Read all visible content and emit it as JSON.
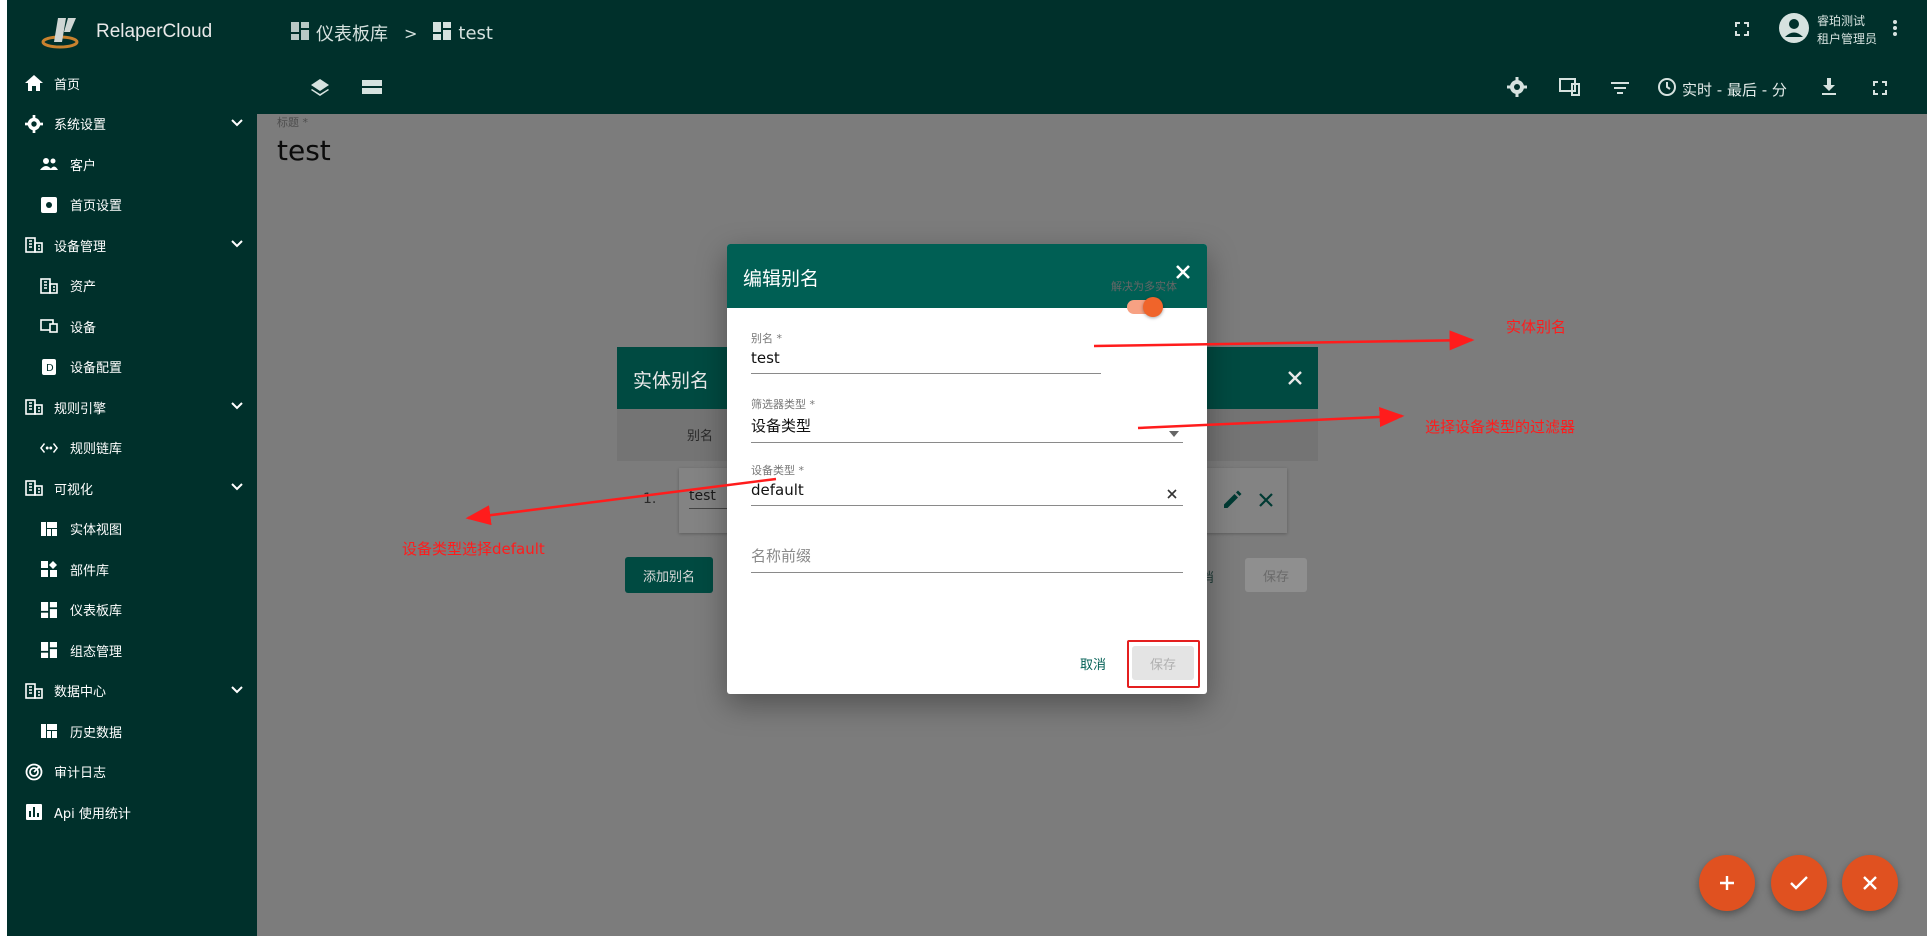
{
  "app": {
    "brand": "RelaperCloud"
  },
  "sidebar": {
    "items": [
      {
        "label": "首页",
        "icon": "home-icon",
        "level": 1
      },
      {
        "label": "系统设置",
        "icon": "gear-icon",
        "level": 1,
        "expandable": true
      },
      {
        "label": "客户",
        "icon": "people-icon",
        "level": 2
      },
      {
        "label": "首页设置",
        "icon": "dashboard-settings-icon",
        "level": 2
      },
      {
        "label": "设备管理",
        "icon": "building-icon",
        "level": 1,
        "expandable": true
      },
      {
        "label": "资产",
        "icon": "building-icon",
        "level": 2
      },
      {
        "label": "设备",
        "icon": "devices-icon",
        "level": 2
      },
      {
        "label": "设备配置",
        "icon": "device-profile-icon",
        "level": 2
      },
      {
        "label": "规则引擎",
        "icon": "building-icon",
        "level": 1,
        "expandable": true
      },
      {
        "label": "规则链库",
        "icon": "rule-chain-icon",
        "level": 2
      },
      {
        "label": "可视化",
        "icon": "building-icon",
        "level": 1,
        "expandable": true
      },
      {
        "label": "实体视图",
        "icon": "view-quilt-icon",
        "level": 2
      },
      {
        "label": "部件库",
        "icon": "widgets-icon",
        "level": 2
      },
      {
        "label": "仪表板库",
        "icon": "dashboard-icon",
        "level": 2
      },
      {
        "label": "组态管理",
        "icon": "dashboard-icon",
        "level": 2
      },
      {
        "label": "数据中心",
        "icon": "building-icon",
        "level": 1,
        "expandable": true
      },
      {
        "label": "历史数据",
        "icon": "view-quilt-icon",
        "level": 2
      },
      {
        "label": "审计日志",
        "icon": "track-changes-icon",
        "level": 1
      },
      {
        "label": "Api 使用统计",
        "icon": "insert-chart-icon",
        "level": 1
      }
    ]
  },
  "topbar": {
    "breadcrumb": [
      {
        "label": "仪表板库",
        "icon": "dashboard-icon"
      },
      {
        "label": "test",
        "icon": "dashboard-icon"
      }
    ],
    "breadcrumb_sep": ">",
    "user_name": "睿珀测试",
    "user_role": "租户管理员",
    "realtime_label": "实时 - 最后 - 分"
  },
  "dashboard": {
    "title_label": "标题 *",
    "title_value": "test"
  },
  "entity_aliases_dialog": {
    "title": "实体别名",
    "column_alias": "别名",
    "row_index": "1.",
    "row_alias": "test",
    "add_button": "添加别名",
    "cancel_button": "消",
    "save_button": "保存"
  },
  "edit_alias_dialog": {
    "title": "编辑别名",
    "alias_label": "别名 *",
    "alias_value": "test",
    "toggle_label": "解决为多实体",
    "toggle_on": true,
    "filter_type_label": "筛选器类型 *",
    "filter_type_value": "设备类型",
    "device_type_label": "设备类型 *",
    "device_type_value": "default",
    "name_prefix_placeholder": "名称前缀",
    "cancel_button": "取消",
    "save_button": "保存"
  },
  "annotations": [
    {
      "text": "实体别名"
    },
    {
      "text": "选择设备类型的过滤器"
    },
    {
      "text": "设备类型选择default"
    }
  ],
  "colors": {
    "sidebar_bg": "#00302b",
    "dialog_header": "#005f54",
    "accent": "#f0642a",
    "annotation": "#ff1c1c"
  }
}
